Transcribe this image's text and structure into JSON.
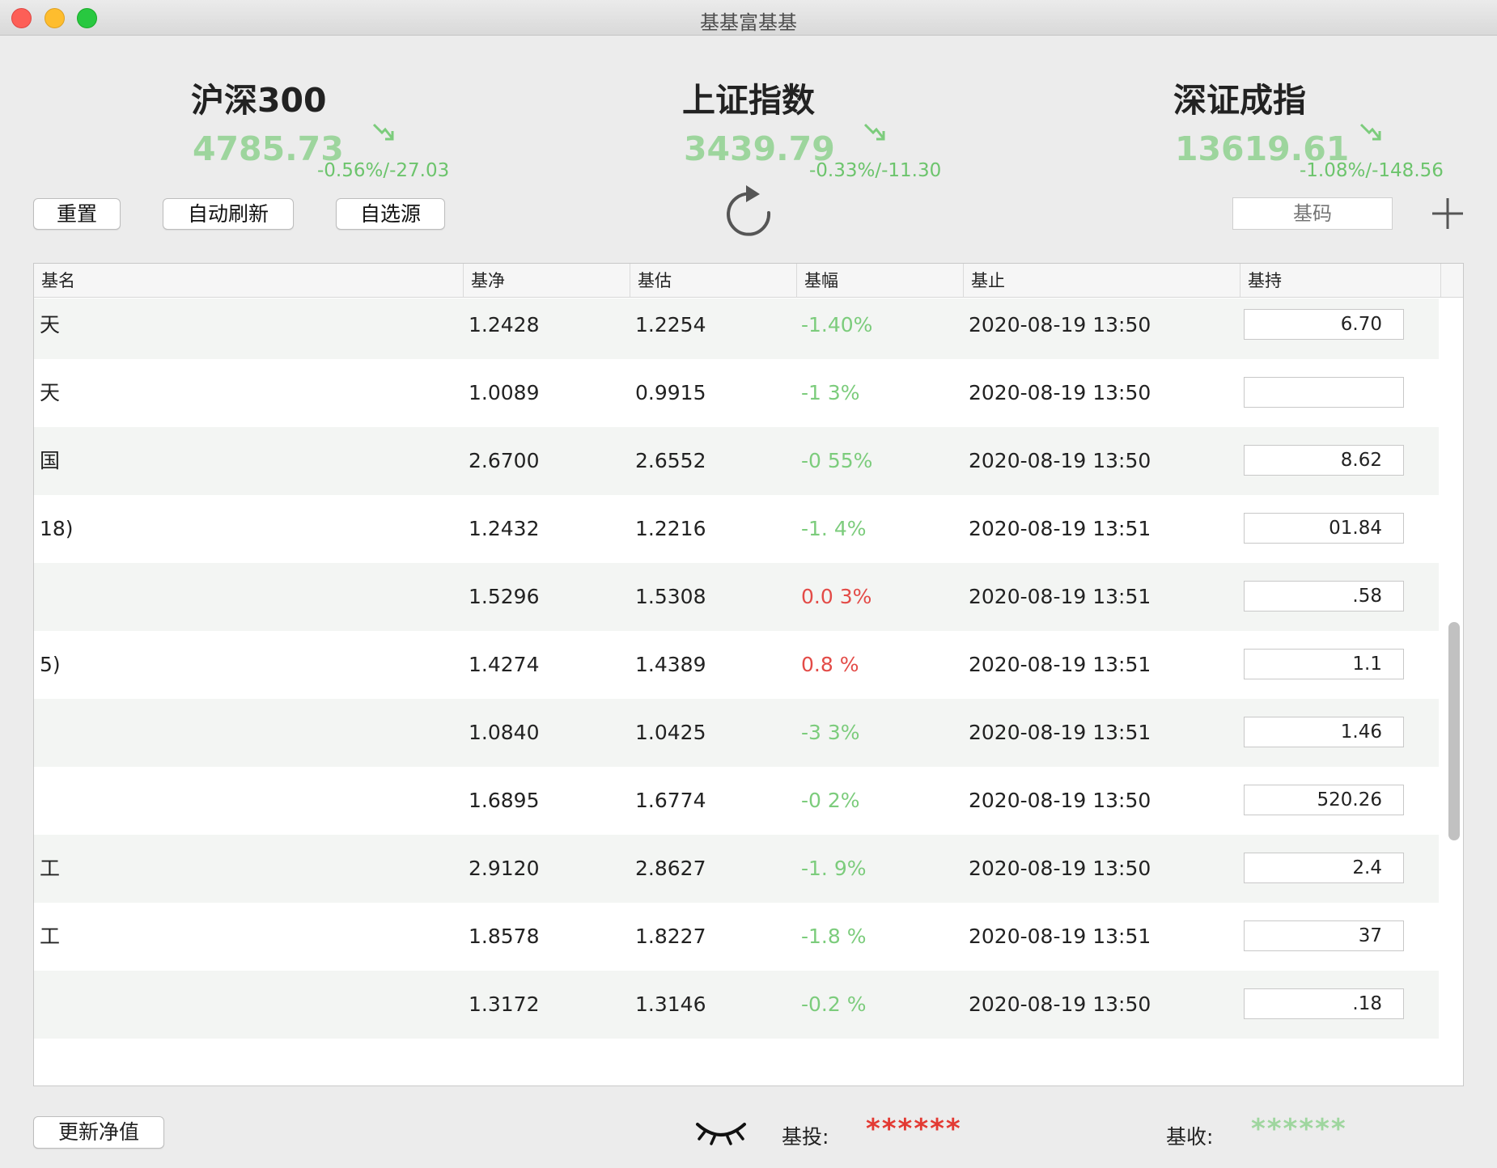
{
  "window": {
    "title": "基基富基基"
  },
  "indices": [
    {
      "name": "沪深300",
      "value": "4785.73",
      "change": "-0.56%/-27.03",
      "trend": "down-trend-icon"
    },
    {
      "name": "上证指数",
      "value": "3439.79",
      "change": "-0.33%/-11.30",
      "trend": "down-trend-icon"
    },
    {
      "name": "深证成指",
      "value": "13619.61",
      "change": "-1.08%/-148.56",
      "trend": "down-trend-icon"
    }
  ],
  "toolbar": {
    "reset_label": "重置",
    "auto_refresh_label": "自动刷新",
    "source_label": "自选源",
    "code_placeholder": "基码",
    "refresh_icon": "refresh-icon",
    "add_icon": "plus-icon"
  },
  "table": {
    "columns": [
      "基名",
      "基净",
      "基估",
      "基幅",
      "基止",
      "基持"
    ],
    "rows": [
      {
        "name": "天",
        "net": "1.2428",
        "est": "1.2254",
        "change": "-1.40%",
        "dir": "down",
        "time": "2020-08-19 13:50",
        "hold": "6.70"
      },
      {
        "name": "天",
        "net": "1.0089",
        "est": "0.9915",
        "change": "-1 3%",
        "dir": "down",
        "time": "2020-08-19 13:50",
        "hold": ""
      },
      {
        "name": "国",
        "net": "2.6700",
        "est": "2.6552",
        "change": "-0 55%",
        "dir": "down",
        "time": "2020-08-19 13:50",
        "hold": "8.62"
      },
      {
        "name": "18)",
        "net": "1.2432",
        "est": "1.2216",
        "change": "-1. 4%",
        "dir": "down",
        "time": "2020-08-19 13:51",
        "hold": "01.84"
      },
      {
        "name": "",
        "net": "1.5296",
        "est": "1.5308",
        "change": "0.0 3%",
        "dir": "up",
        "time": "2020-08-19 13:51",
        "hold": ".58"
      },
      {
        "name": "5)",
        "net": "1.4274",
        "est": "1.4389",
        "change": "0.8 %",
        "dir": "up",
        "time": "2020-08-19 13:51",
        "hold": "1.1"
      },
      {
        "name": "",
        "net": "1.0840",
        "est": "1.0425",
        "change": "-3 3%",
        "dir": "down",
        "time": "2020-08-19 13:51",
        "hold": "1.46"
      },
      {
        "name": "",
        "net": "1.6895",
        "est": "1.6774",
        "change": "-0 2%",
        "dir": "down",
        "time": "2020-08-19 13:50",
        "hold": "520.26"
      },
      {
        "name": "工",
        "net": "2.9120",
        "est": "2.8627",
        "change": "-1. 9%",
        "dir": "down",
        "time": "2020-08-19 13:50",
        "hold": "2.4"
      },
      {
        "name": "工",
        "net": "1.8578",
        "est": "1.8227",
        "change": "-1.8 %",
        "dir": "down",
        "time": "2020-08-19 13:51",
        "hold": "37"
      },
      {
        "name": "",
        "net": "1.3172",
        "est": "1.3146",
        "change": "-0.2 %",
        "dir": "down",
        "time": "2020-08-19 13:50",
        "hold": ".18"
      }
    ]
  },
  "footer": {
    "update_label": "更新净值",
    "eye_icon": "eye-closed-icon",
    "invest_label": "基投:",
    "invest_value": "******",
    "income_label": "基收:",
    "income_value": "******"
  },
  "colors": {
    "up": "#e34b47",
    "down": "#7ccc7c",
    "invest": "#e33a33",
    "income": "#9fd69f"
  }
}
